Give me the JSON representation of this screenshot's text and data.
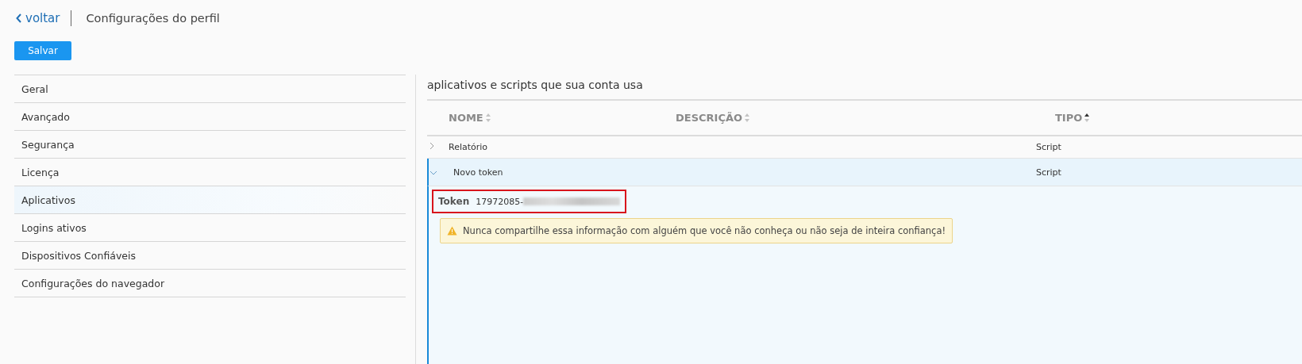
{
  "header": {
    "back_link": "voltar",
    "title": "Configurações do perfil"
  },
  "save_button": "Salvar",
  "sidebar": {
    "items": [
      {
        "label": "Geral",
        "selected": false
      },
      {
        "label": "Avançado",
        "selected": false
      },
      {
        "label": "Segurança",
        "selected": false
      },
      {
        "label": "Licença",
        "selected": false
      },
      {
        "label": "Aplicativos",
        "selected": true
      },
      {
        "label": "Logins ativos",
        "selected": false
      },
      {
        "label": "Dispositivos Confiáveis",
        "selected": false
      },
      {
        "label": "Configurações do navegador",
        "selected": false
      }
    ]
  },
  "section_title": "aplicativos e scripts que sua conta usa",
  "table": {
    "columns": [
      {
        "label": "NOME",
        "sorted_ascending": false
      },
      {
        "label": "DESCRIÇÃO",
        "sorted_ascending": false
      },
      {
        "label": "TIPO",
        "sorted_ascending": true
      }
    ],
    "rows": [
      {
        "name": "Relatório",
        "type": "Script",
        "expanded": false
      },
      {
        "name": "Novo token",
        "type": "Script",
        "expanded": true,
        "details": {
          "token_label": "Token",
          "token_value": "17972085-",
          "redacted": true,
          "highlighted": true,
          "warning": "Nunca compartilhe essa informação com alguém que você não conheça ou não seja de inteira confiança!"
        }
      }
    ]
  }
}
